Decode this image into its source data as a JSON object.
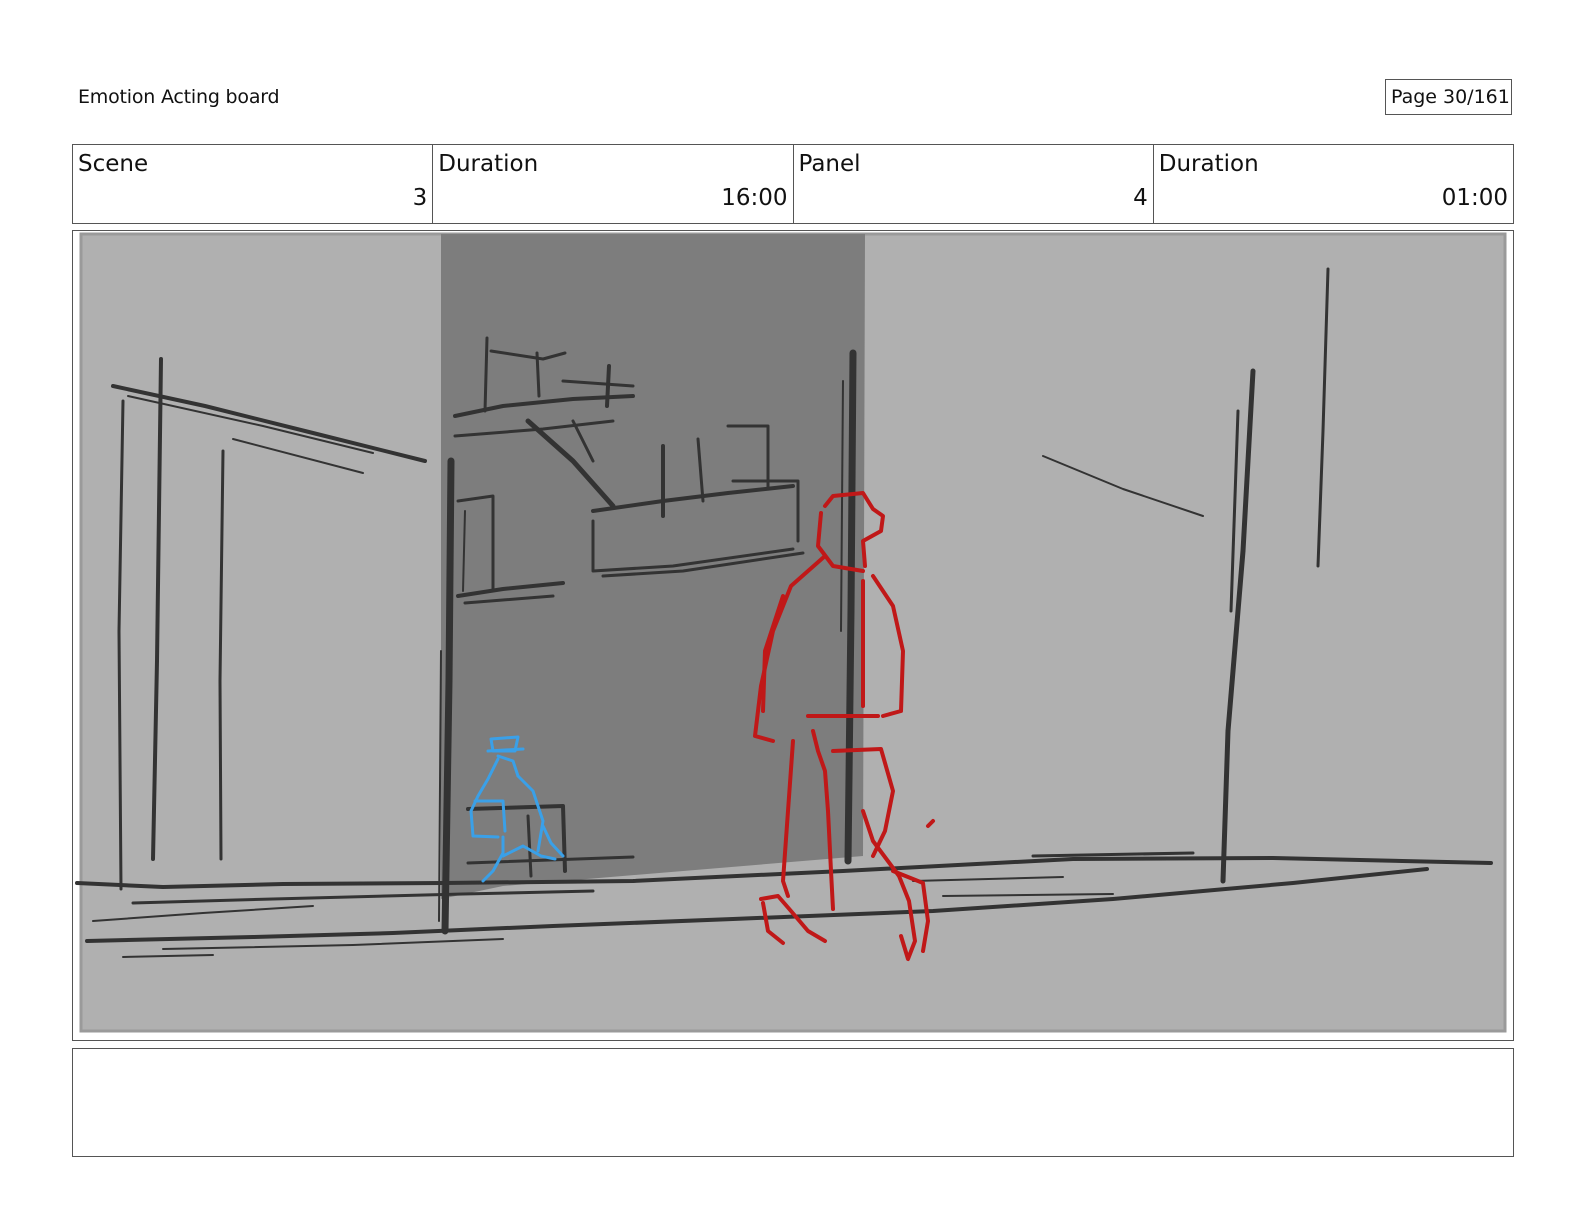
{
  "header": {
    "title": "Emotion Acting board",
    "page_label": "Page",
    "page_value": "30/161"
  },
  "info": {
    "scene": {
      "label": "Scene",
      "value": "3"
    },
    "scene_duration": {
      "label": "Duration",
      "value": "16:00"
    },
    "panel": {
      "label": "Panel",
      "value": "4"
    },
    "panel_duration": {
      "label": "Duration",
      "value": "01:00"
    }
  },
  "panel_image": {
    "ink_colors": {
      "background": "#b0b0b0",
      "shadow": "#7d7d7d",
      "line": "#333333",
      "character_red": "#c01818",
      "character_blue": "#3aa0e8"
    }
  },
  "notes": {
    "text": ""
  }
}
